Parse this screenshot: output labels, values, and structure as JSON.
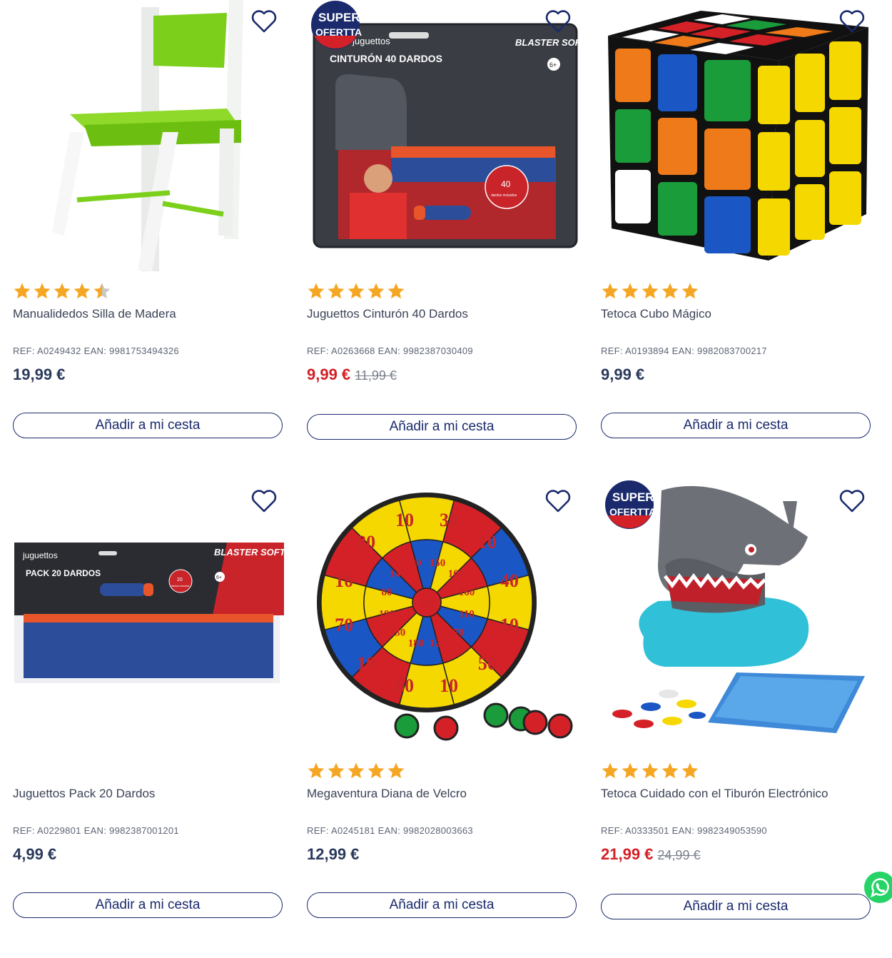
{
  "accent_color": "#1a2a6c",
  "sale_color": "#d32127",
  "star_color": "#f5a623",
  "products": [
    {
      "name": "Manualidedos Silla de Madera",
      "ref": "REF: A0249432 EAN: 9981753494326",
      "price": "19,99 €",
      "old_price": "",
      "rating": 4.5,
      "button": "Añadir a mi cesta",
      "badge": ""
    },
    {
      "name": "Juguettos Cinturón 40 Dardos",
      "ref": "REF: A0263668 EAN: 9982387030409",
      "price": "9,99 €",
      "old_price": "11,99 €",
      "rating": 5,
      "button": "Añadir a mi cesta",
      "badge": "SUPER OFERTTA",
      "image_text": {
        "brand": "juguettos",
        "title": "CINTURÓN 40 DARDOS",
        "logo": "BLASTER SOFT",
        "age": "6+",
        "bubble_num": "40",
        "bubble_text": "dardos incluidos"
      }
    },
    {
      "name": "Tetoca Cubo Mágico",
      "ref": "REF: A0193894 EAN: 9982083700217",
      "price": "9,99 €",
      "old_price": "",
      "rating": 5,
      "button": "Añadir a mi cesta",
      "badge": ""
    },
    {
      "name": "Juguettos Pack 20 Dardos",
      "ref": "REF: A0229801 EAN: 9982387001201",
      "price": "4,99 €",
      "old_price": "",
      "rating": 0,
      "button": "Añadir a mi cesta",
      "badge": "",
      "image_text": {
        "brand": "juguettos",
        "title": "PACK 20 DARDOS",
        "logo": "BLASTER SOFT",
        "age": "6+",
        "bubble_num": "20",
        "bubble_text": "dardos incluidos"
      }
    },
    {
      "name": "Megaventura Diana de Velcro",
      "ref": "REF: A0245181 EAN: 9982028003663",
      "price": "12,99 €",
      "old_price": "",
      "rating": 5,
      "button": "Añadir a mi cesta",
      "badge": "",
      "dartboard": {
        "outer": [
          "10",
          "30",
          "10",
          "40",
          "10",
          "50",
          "10",
          "60",
          "10",
          "70",
          "10",
          "20"
        ],
        "inner": [
          "90",
          "150",
          "100",
          "160",
          "110",
          "170",
          "120",
          "180",
          "130",
          "190",
          "80",
          "140"
        ],
        "center": "200"
      }
    },
    {
      "name": "Tetoca Cuidado con el Tiburón Electrónico",
      "ref": "REF: A0333501 EAN: 9982349053590",
      "price": "21,99 €",
      "old_price": "24,99 €",
      "rating": 5,
      "button": "Añadir a mi cesta",
      "badge": "SUPER OFERTTA"
    }
  ],
  "badge_text": {
    "line1": "SUPER",
    "line2": "OFERTTA"
  }
}
